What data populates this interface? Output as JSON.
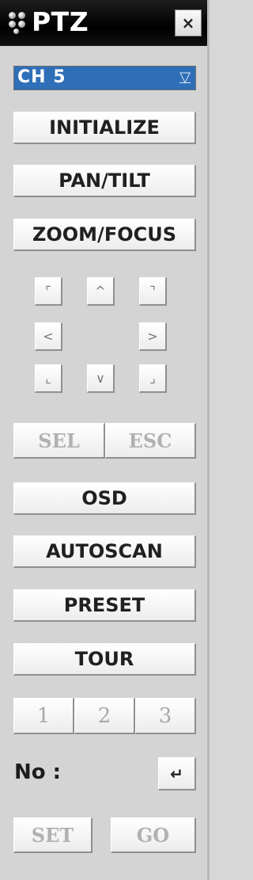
{
  "window": {
    "title": "PTZ",
    "close_label": "×"
  },
  "channel": {
    "value": "CH 5",
    "arrow": "▽"
  },
  "buttons": {
    "initialize": "INITIALIZE",
    "pan_tilt": "PAN/TILT",
    "zoom_focus": "ZOOM/FOCUS",
    "sel": "SEL",
    "esc": "ESC",
    "osd": "OSD",
    "autoscan": "AUTOSCAN",
    "preset": "PRESET",
    "tour": "TOUR",
    "set": "SET",
    "go": "GO",
    "enter": "↵"
  },
  "direction_pad": {
    "up_left": "⌜",
    "up": "^",
    "up_right": "⌝",
    "left": "<",
    "right": ">",
    "down_left": "⌞",
    "down": "∨",
    "down_right": "⌟"
  },
  "numbers": [
    "1",
    "2",
    "3"
  ],
  "no_field": {
    "label": "No :"
  }
}
